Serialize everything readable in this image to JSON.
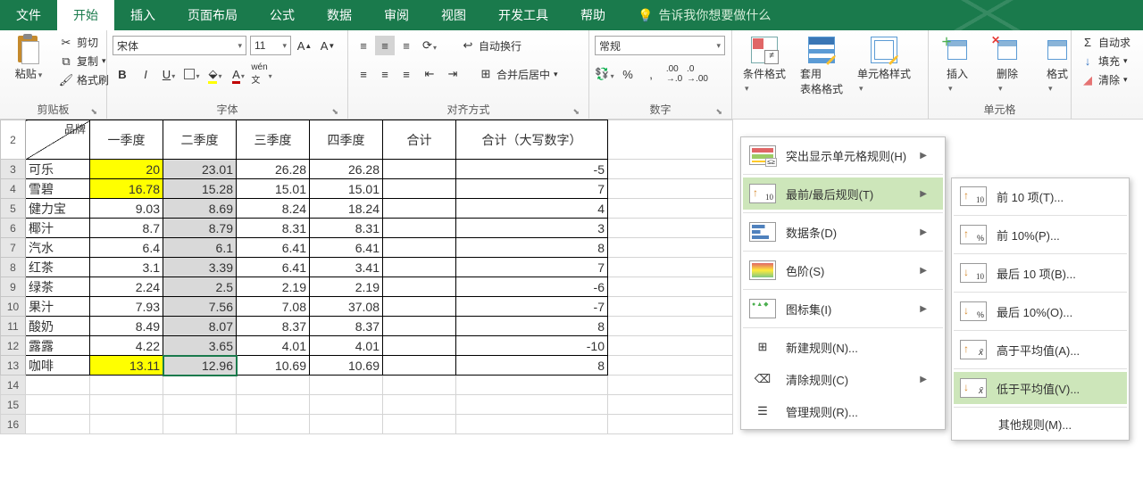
{
  "tabs": {
    "file": "文件",
    "home": "开始",
    "insert": "插入",
    "layout": "页面布局",
    "formulas": "公式",
    "data": "数据",
    "review": "审阅",
    "view": "视图",
    "dev": "开发工具",
    "help": "帮助",
    "tellme": "告诉我你想要做什么"
  },
  "clipboard": {
    "group": "剪贴板",
    "paste": "粘贴",
    "cut": "剪切",
    "copy": "复制",
    "painter": "格式刷"
  },
  "font": {
    "group": "字体",
    "name": "宋体",
    "size": "11"
  },
  "align": {
    "group": "对齐方式",
    "wrap": "自动换行",
    "merge": "合并后居中"
  },
  "number": {
    "group": "数字",
    "format": "常规"
  },
  "styles": {
    "cond": "条件格式",
    "table": "套用\n表格格式",
    "cell": "单元格样式"
  },
  "cells": {
    "group": "单元格",
    "insert": "插入",
    "delete": "删除",
    "format": "格式"
  },
  "editing": {
    "sum": "自动求",
    "fill": "填充",
    "clear": "清除"
  },
  "cf_menu": {
    "highlight": "突出显示单元格规则(H)",
    "toprules": "最前/最后规则(T)",
    "databar": "数据条(D)",
    "colorscale": "色阶(S)",
    "iconset": "图标集(I)",
    "newrule": "新建规则(N)...",
    "clear": "清除规则(C)",
    "manage": "管理规则(R)..."
  },
  "top_menu": {
    "top10": "前 10 项(T)...",
    "top10p": "前 10%(P)...",
    "bot10": "最后 10 项(B)...",
    "bot10p": "最后 10%(O)...",
    "above": "高于平均值(A)...",
    "below": "低于平均值(V)...",
    "more": "其他规则(M)..."
  },
  "grid": {
    "diag_top": "品牌",
    "diag_bot": "",
    "headers": [
      "一季度",
      "二季度",
      "三季度",
      "四季度",
      "合计",
      "合计（大写数字）"
    ],
    "rows": [
      {
        "n": 3,
        "brand": "可乐",
        "q1": "20",
        "q2": "23.01",
        "q3": "26.28",
        "q4": "26.28",
        "sum": "",
        "sumc": "-5",
        "hl": [
          "q1"
        ]
      },
      {
        "n": 4,
        "brand": "雪碧",
        "q1": "16.78",
        "q2": "15.28",
        "q3": "15.01",
        "q4": "15.01",
        "sum": "",
        "sumc": "7",
        "hl": [
          "q1"
        ]
      },
      {
        "n": 5,
        "brand": "健力宝",
        "q1": "9.03",
        "q2": "8.69",
        "q3": "8.24",
        "q4": "18.24",
        "sum": "",
        "sumc": "4",
        "hl": []
      },
      {
        "n": 6,
        "brand": "椰汁",
        "q1": "8.7",
        "q2": "8.79",
        "q3": "8.31",
        "q4": "8.31",
        "sum": "",
        "sumc": "3",
        "hl": []
      },
      {
        "n": 7,
        "brand": "汽水",
        "q1": "6.4",
        "q2": "6.1",
        "q3": "6.41",
        "q4": "6.41",
        "sum": "",
        "sumc": "8",
        "hl": []
      },
      {
        "n": 8,
        "brand": "红茶",
        "q1": "3.1",
        "q2": "3.39",
        "q3": "6.41",
        "q4": "3.41",
        "sum": "",
        "sumc": "7",
        "hl": []
      },
      {
        "n": 9,
        "brand": "绿茶",
        "q1": "2.24",
        "q2": "2.5",
        "q3": "2.19",
        "q4": "2.19",
        "sum": "",
        "sumc": "-6",
        "hl": []
      },
      {
        "n": 10,
        "brand": "果汁",
        "q1": "7.93",
        "q2": "7.56",
        "q3": "7.08",
        "q4": "37.08",
        "sum": "",
        "sumc": "-7",
        "hl": []
      },
      {
        "n": 11,
        "brand": "酸奶",
        "q1": "8.49",
        "q2": "8.07",
        "q3": "8.37",
        "q4": "8.37",
        "sum": "",
        "sumc": "8",
        "hl": []
      },
      {
        "n": 12,
        "brand": "露露",
        "q1": "4.22",
        "q2": "3.65",
        "q3": "4.01",
        "q4": "4.01",
        "sum": "",
        "sumc": "-10",
        "hl": []
      },
      {
        "n": 13,
        "brand": "咖啡",
        "q1": "13.11",
        "q2": "12.96",
        "q3": "10.69",
        "q4": "10.69",
        "sum": "",
        "sumc": "8",
        "hl": [
          "q1"
        ]
      }
    ]
  }
}
